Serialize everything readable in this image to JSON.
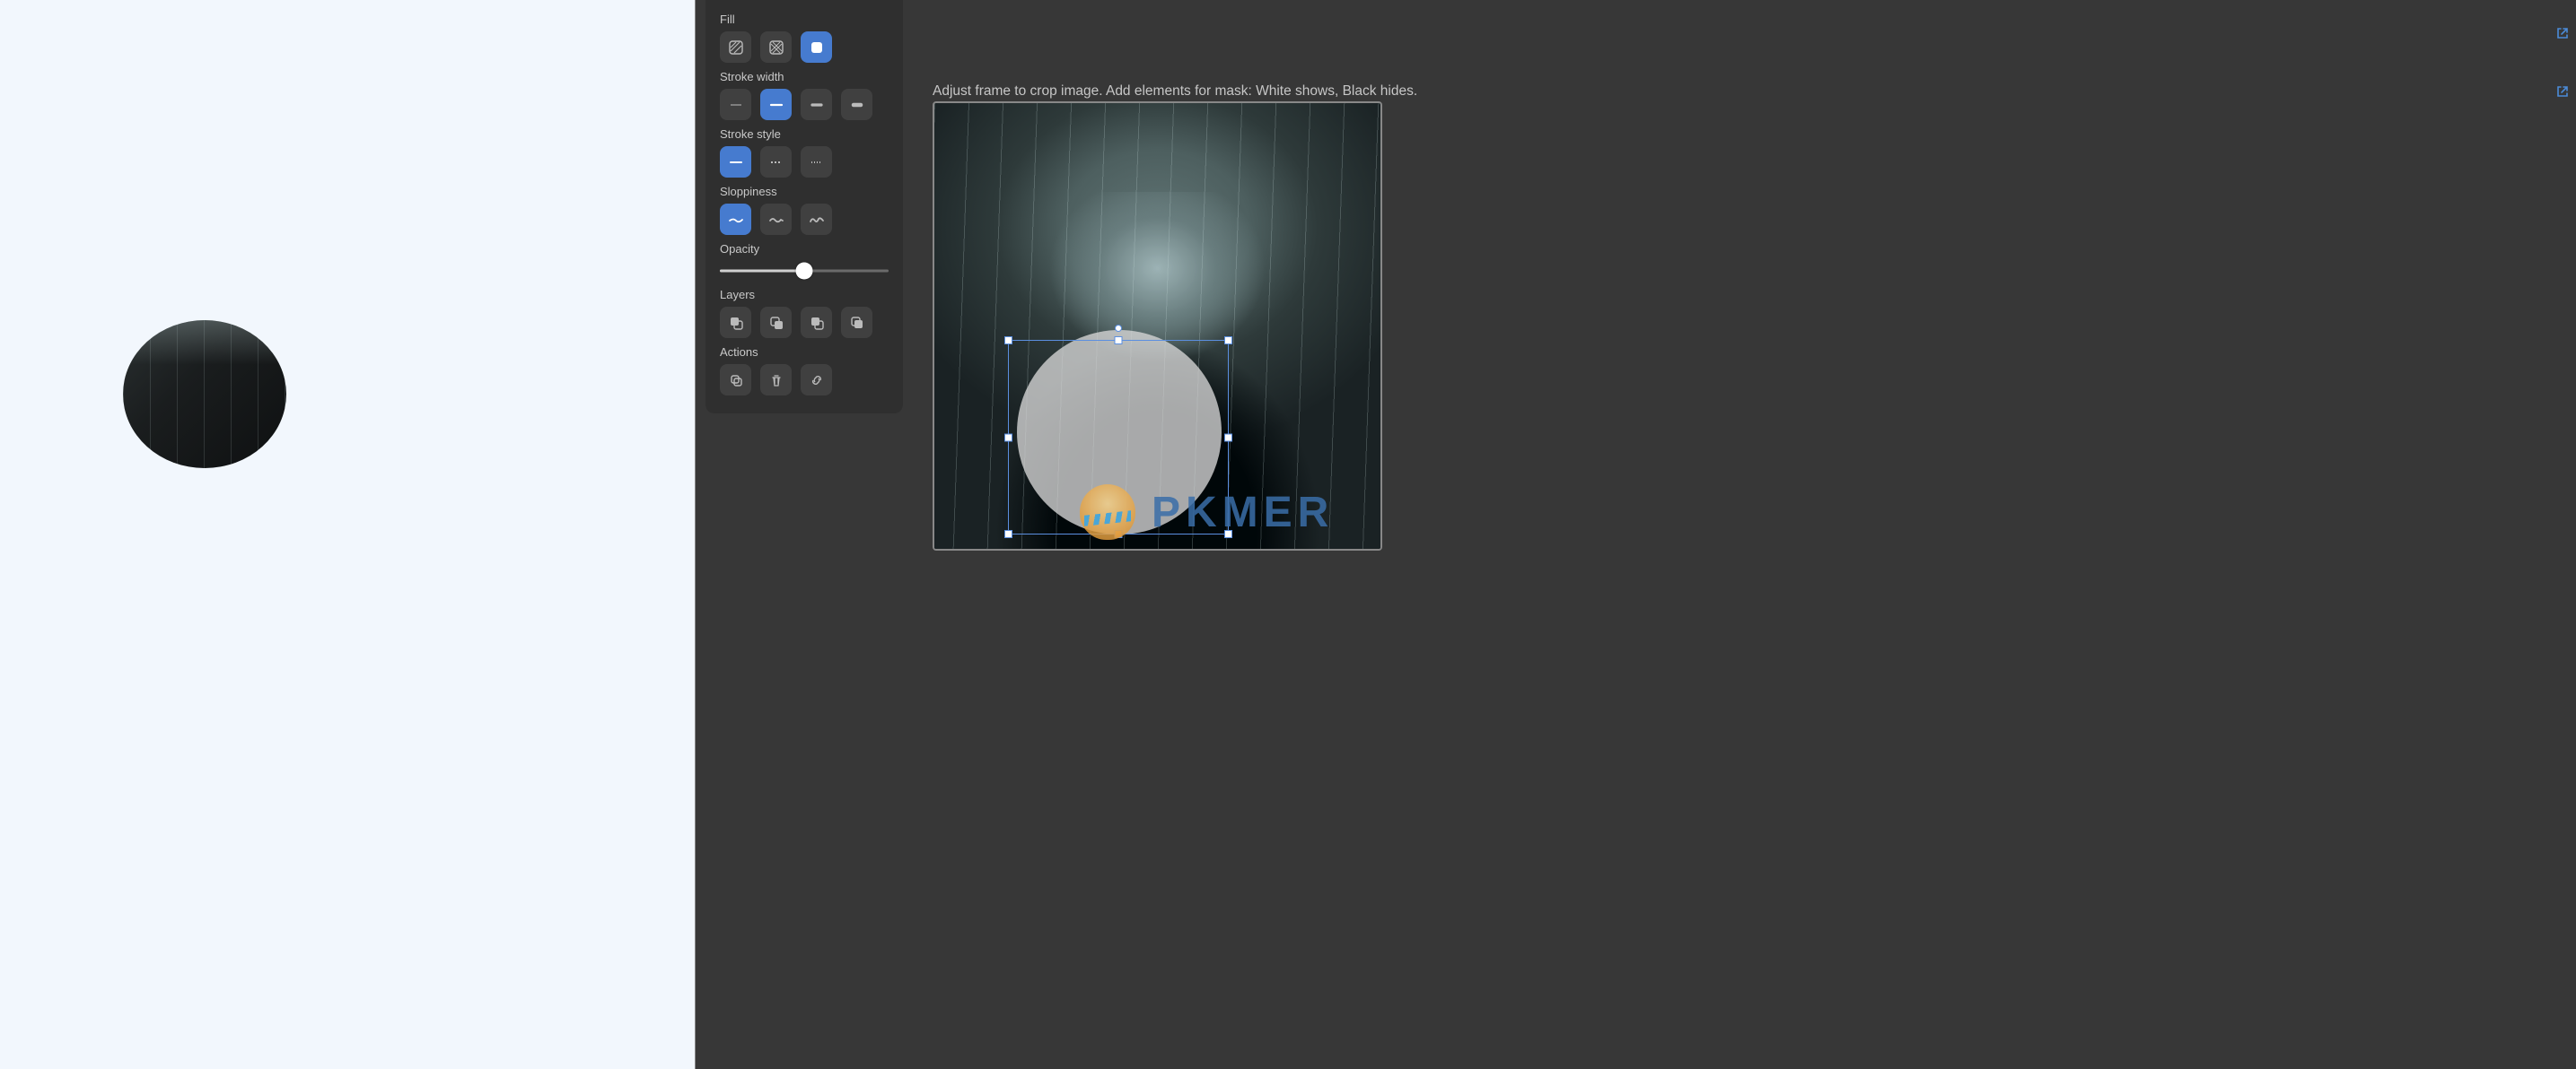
{
  "hint_text": "Adjust frame to crop image. Add elements for mask: White shows, Black hides.",
  "watermark_text": "PKMER",
  "panel": {
    "fill_label": "Fill",
    "stroke_width_label": "Stroke width",
    "stroke_style_label": "Stroke style",
    "sloppiness_label": "Sloppiness",
    "opacity_label": "Opacity",
    "layers_label": "Layers",
    "actions_label": "Actions"
  },
  "fill_options": [
    "hachure",
    "cross-hatch",
    "solid"
  ],
  "fill_selected": "solid",
  "stroke_width_options": [
    "thin",
    "medium",
    "thick",
    "extra"
  ],
  "stroke_width_selected": "medium",
  "stroke_style_options": [
    "solid",
    "dashed",
    "dotted"
  ],
  "stroke_style_selected": "solid",
  "sloppiness_options": [
    "architect",
    "artist",
    "cartoonist"
  ],
  "sloppiness_selected": "architect",
  "opacity_value": 50,
  "layer_actions": [
    "send-to-back",
    "send-backward",
    "bring-forward",
    "bring-to-front"
  ],
  "actions": [
    "duplicate",
    "delete",
    "link"
  ],
  "colors": {
    "accent": "#467BCF",
    "panel_bg": "#2F2F2F",
    "app_bg": "#373737",
    "preview_bg": "#F2F7FD"
  }
}
